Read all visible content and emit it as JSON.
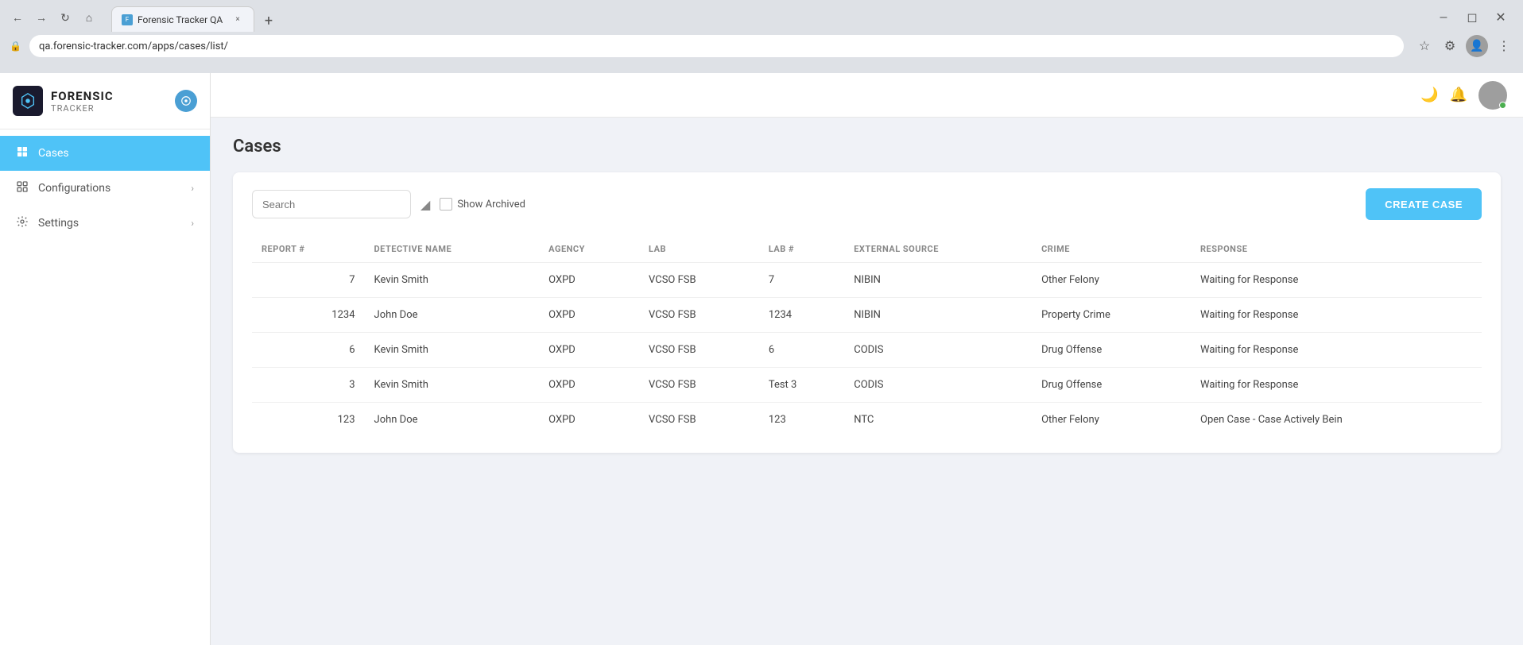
{
  "browser": {
    "tab_title": "Forensic Tracker QA",
    "url": "qa.forensic-tracker.com/apps/cases/list/",
    "new_tab_symbol": "+",
    "close_symbol": "×"
  },
  "app": {
    "logo_title": "FORENSIC",
    "logo_subtitle": "TRACKER"
  },
  "topbar": {
    "moon_icon": "🌙",
    "bell_icon": "🔔"
  },
  "sidebar": {
    "items": [
      {
        "label": "Cases",
        "icon": "📋",
        "active": true
      },
      {
        "label": "Configurations",
        "icon": "⊞",
        "has_chevron": true
      },
      {
        "label": "Settings",
        "icon": "⚙",
        "has_chevron": true
      }
    ]
  },
  "page": {
    "title": "Cases"
  },
  "toolbar": {
    "search_placeholder": "Search",
    "show_archived_label": "Show Archived",
    "create_case_label": "CREATE CASE"
  },
  "table": {
    "columns": [
      {
        "key": "report_num",
        "label": "REPORT #"
      },
      {
        "key": "detective_name",
        "label": "DETECTIVE NAME"
      },
      {
        "key": "agency",
        "label": "AGENCY"
      },
      {
        "key": "lab",
        "label": "LAB"
      },
      {
        "key": "lab_num",
        "label": "LAB #"
      },
      {
        "key": "external_source",
        "label": "EXTERNAL SOURCE"
      },
      {
        "key": "crime",
        "label": "CRIME"
      },
      {
        "key": "response",
        "label": "RESPONSE"
      }
    ],
    "rows": [
      {
        "report_num": "7",
        "detective_name": "Kevin Smith",
        "agency": "OXPD",
        "lab": "VCSO FSB",
        "lab_num": "7",
        "external_source": "NIBIN",
        "crime": "Other Felony",
        "response": "Waiting for Response"
      },
      {
        "report_num": "1234",
        "detective_name": "John Doe",
        "agency": "OXPD",
        "lab": "VCSO FSB",
        "lab_num": "1234",
        "external_source": "NIBIN",
        "crime": "Property Crime",
        "response": "Waiting for Response"
      },
      {
        "report_num": "6",
        "detective_name": "Kevin Smith",
        "agency": "OXPD",
        "lab": "VCSO FSB",
        "lab_num": "6",
        "external_source": "CODIS",
        "crime": "Drug Offense",
        "response": "Waiting for Response"
      },
      {
        "report_num": "3",
        "detective_name": "Kevin Smith",
        "agency": "OXPD",
        "lab": "VCSO FSB",
        "lab_num": "Test 3",
        "external_source": "CODIS",
        "crime": "Drug Offense",
        "response": "Waiting for Response"
      },
      {
        "report_num": "123",
        "detective_name": "John Doe",
        "agency": "OXPD",
        "lab": "VCSO FSB",
        "lab_num": "123",
        "external_source": "NTC",
        "crime": "Other Felony",
        "response": "Open Case - Case Actively Bein"
      }
    ]
  }
}
